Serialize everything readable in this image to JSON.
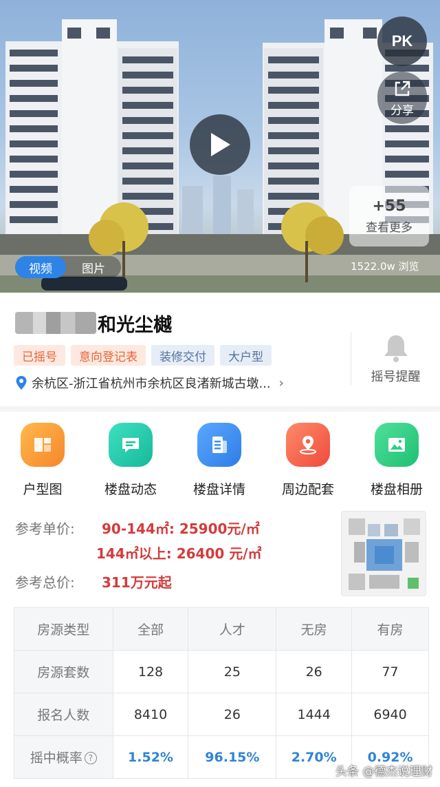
{
  "hero": {
    "views_text": "1522.0w 浏览",
    "more_count": "+55",
    "more_label": "查看更多",
    "pk_label": "PK",
    "share_label": "分享",
    "tab_video": "视频",
    "tab_photo": "图片"
  },
  "project": {
    "title_visible": "和光尘樾",
    "tags": [
      "已摇号",
      "意向登记表",
      "装修交付",
      "大户型"
    ],
    "address": "余杭区-浙江省杭州市余杭区良渚新城古墩...",
    "bell_label": "摇号提醒"
  },
  "actions": [
    {
      "label": "户型图",
      "icon": "floor-plan-icon",
      "color": "#f99a2b"
    },
    {
      "label": "楼盘动态",
      "icon": "news-icon",
      "color": "#21c7a8"
    },
    {
      "label": "楼盘详情",
      "icon": "document-icon",
      "color": "#3a8ff0"
    },
    {
      "label": "周边配套",
      "icon": "location-icon",
      "color": "#f4604e"
    },
    {
      "label": "楼盘相册",
      "icon": "album-icon",
      "color": "#2fcf84"
    }
  ],
  "price": {
    "unit_label": "参考单价:",
    "unit_line1": "90-144㎡: 25900元/㎡",
    "unit_line2": "144㎡以上: 26400 元/㎡",
    "total_label": "参考总价:",
    "total_value": "311万元起"
  },
  "table": {
    "header": [
      "房源类型",
      "全部",
      "人才",
      "无房",
      "有房"
    ],
    "rows": [
      [
        "房源套数",
        "128",
        "25",
        "26",
        "77"
      ],
      [
        "报名人数",
        "8410",
        "26",
        "1444",
        "6940"
      ]
    ],
    "rate_label": "摇中概率",
    "rates": [
      "1.52%",
      "96.15%",
      "2.70%",
      "0.92%"
    ]
  },
  "watermark": "头条 @德杰说理财"
}
